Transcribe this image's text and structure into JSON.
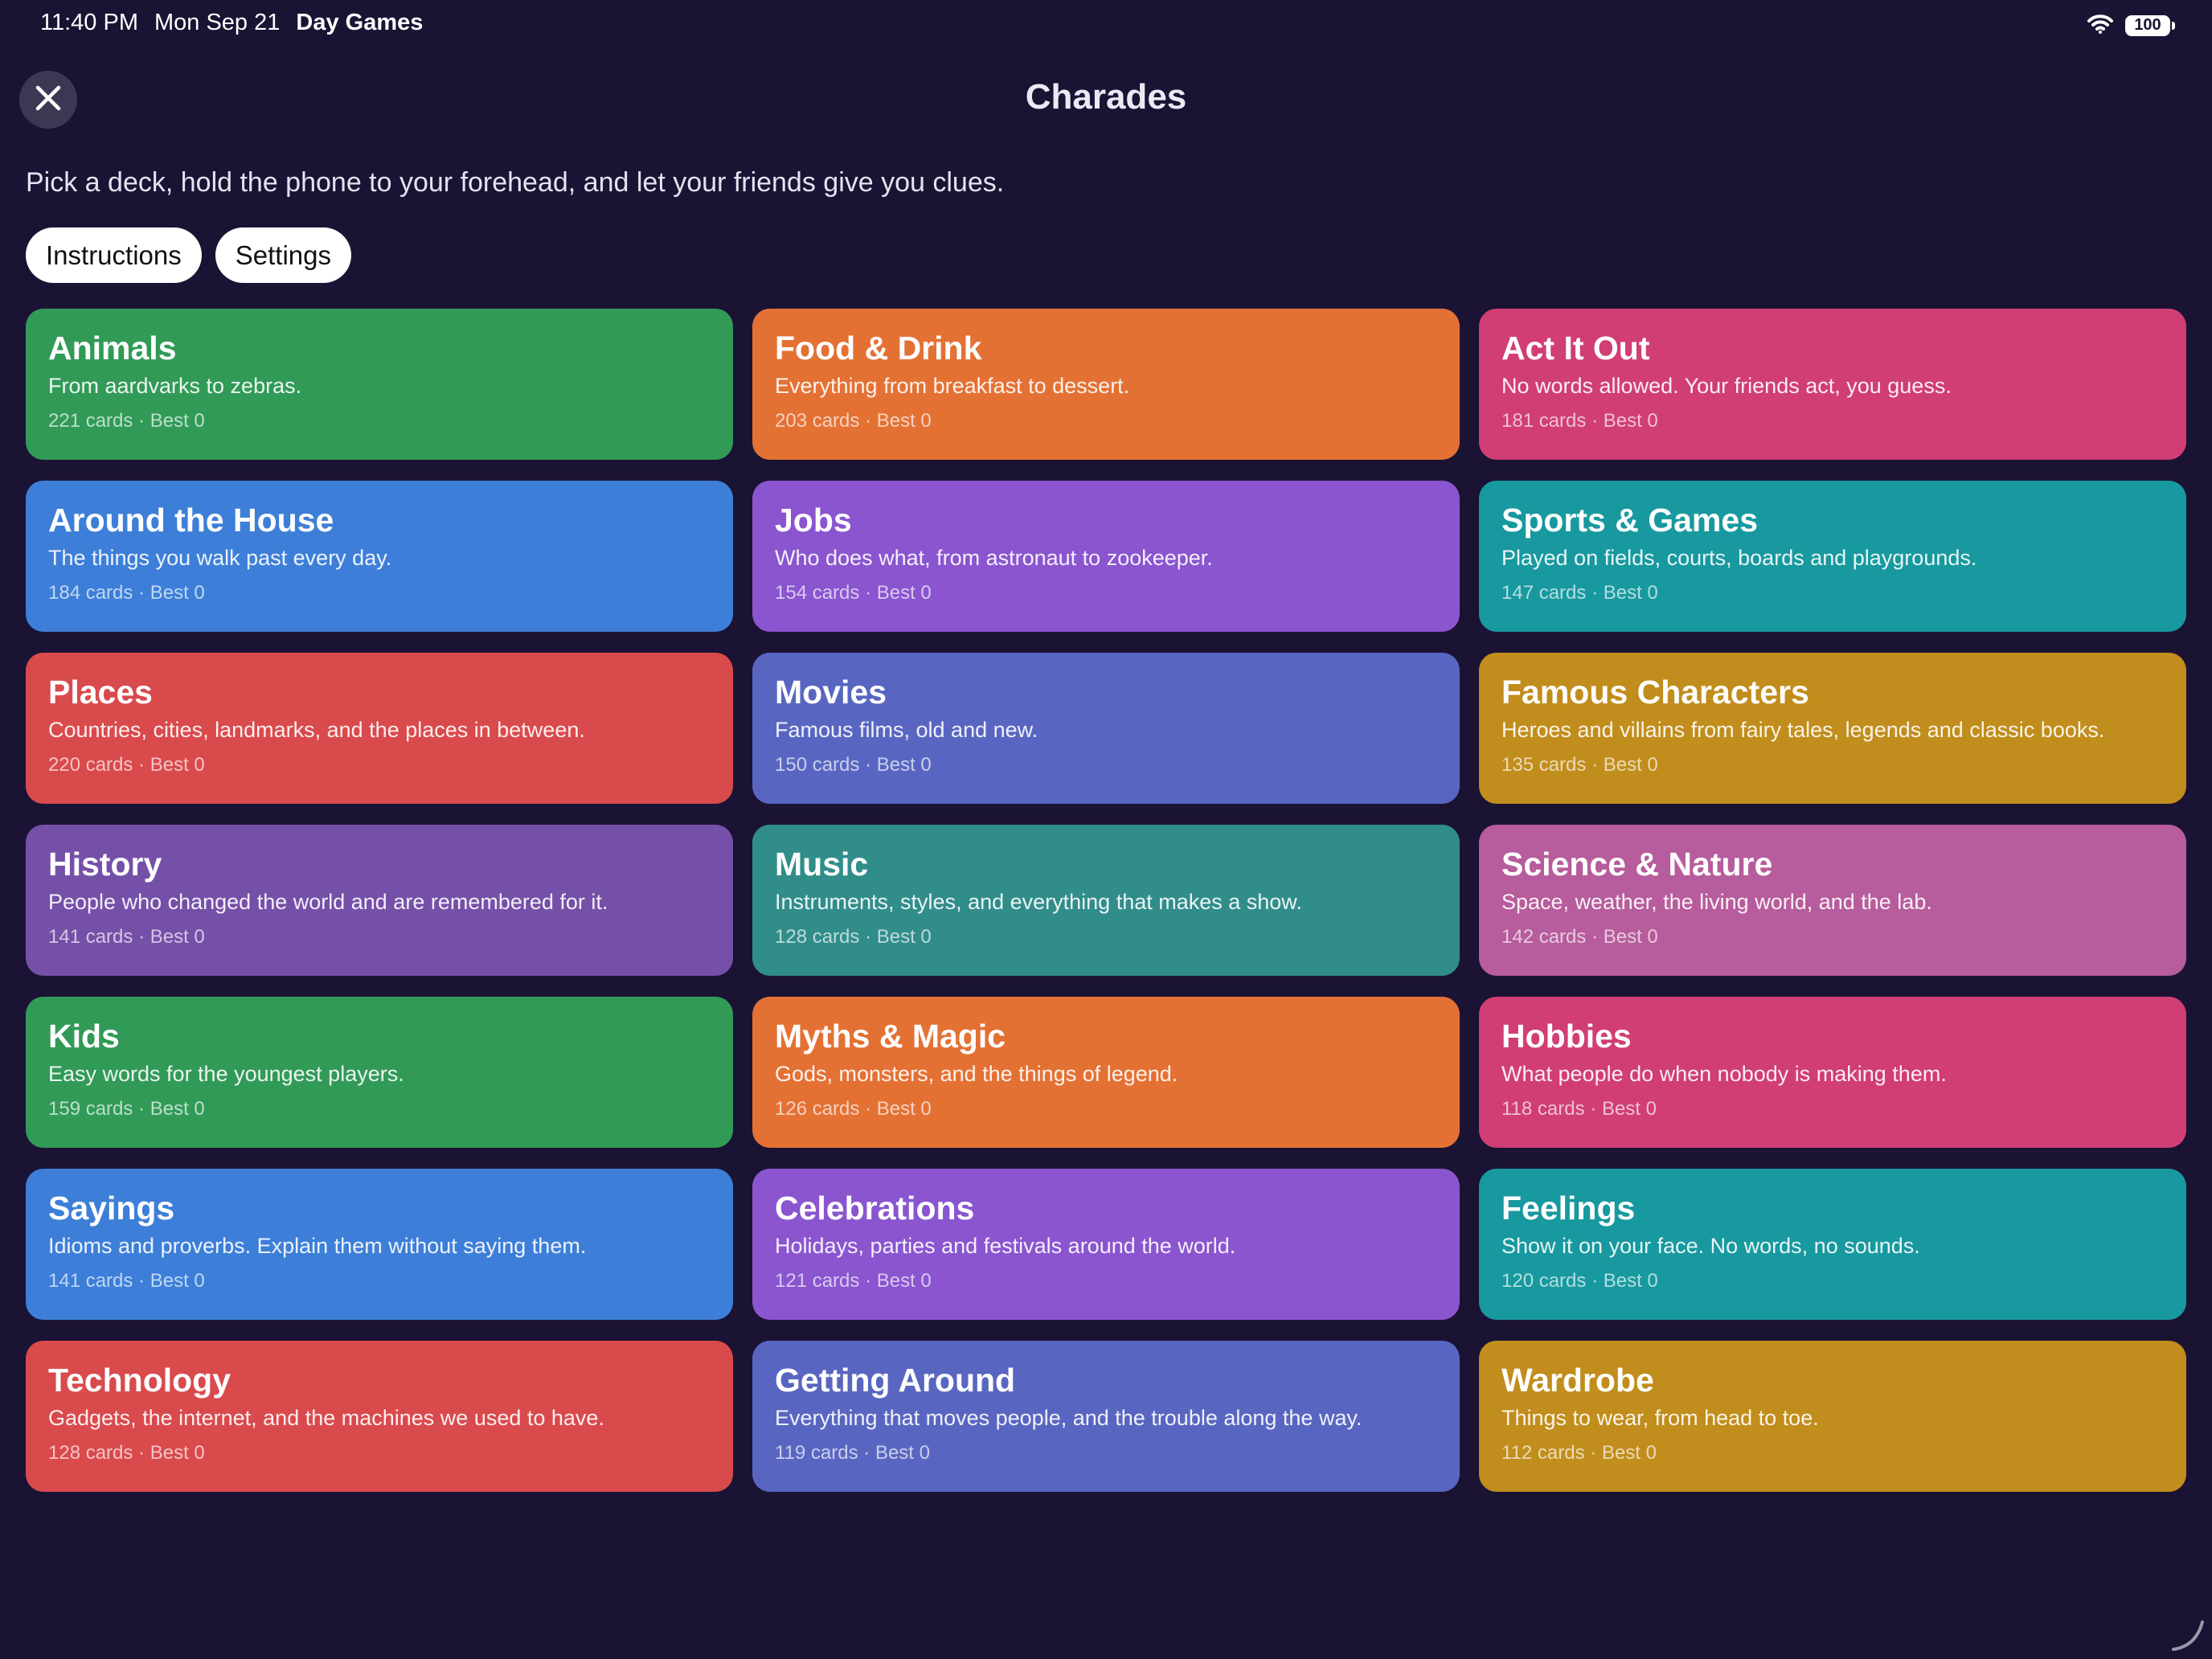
{
  "status_bar": {
    "time": "11:40 PM",
    "date": "Mon Sep 21",
    "app_name": "Day Games",
    "battery": "100"
  },
  "header": {
    "title": "Charades"
  },
  "subtitle": "Pick a deck, hold the phone to your forehead, and let your friends give you clues.",
  "buttons": {
    "instructions": "Instructions",
    "settings": "Settings"
  },
  "decks": [
    {
      "name": "Animals",
      "description": "From aardvarks to zebras.",
      "meta": "221 cards · Best 0",
      "color": "#319a57"
    },
    {
      "name": "Food & Drink",
      "description": "Everything from breakfast to dessert.",
      "meta": "203 cards · Best 0",
      "color": "#e47134"
    },
    {
      "name": "Act It Out",
      "description": "No words allowed. Your friends act, you guess.",
      "meta": "181 cards · Best 0",
      "color": "#d03e74"
    },
    {
      "name": "Around the House",
      "description": "The things you walk past every day.",
      "meta": "184 cards · Best 0",
      "color": "#3d7fd8"
    },
    {
      "name": "Jobs",
      "description": "Who does what, from astronaut to zookeeper.",
      "meta": "154 cards · Best 0",
      "color": "#8a55cf"
    },
    {
      "name": "Sports & Games",
      "description": "Played on fields, courts, boards and playgrounds.",
      "meta": "147 cards · Best 0",
      "color": "#17999f"
    },
    {
      "name": "Places",
      "description": "Countries, cities, landmarks, and the places in between.",
      "meta": "220 cards · Best 0",
      "color": "#d94a4d"
    },
    {
      "name": "Movies",
      "description": "Famous films, old and new.",
      "meta": "150 cards · Best 0",
      "color": "#5966c1"
    },
    {
      "name": "Famous Characters",
      "description": "Heroes and villains from fairy tales, legends and classic books.",
      "meta": "135 cards · Best 0",
      "color": "#c18d1c"
    },
    {
      "name": "History",
      "description": "People who changed the world and are remembered for it.",
      "meta": "141 cards · Best 0",
      "color": "#7550a8"
    },
    {
      "name": "Music",
      "description": "Instruments, styles, and everything that makes a show.",
      "meta": "128 cards · Best 0",
      "color": "#318d8a"
    },
    {
      "name": "Science & Nature",
      "description": "Space, weather, the living world, and the lab.",
      "meta": "142 cards · Best 0",
      "color": "#b75c9c"
    },
    {
      "name": "Kids",
      "description": "Easy words for the youngest players.",
      "meta": "159 cards · Best 0",
      "color": "#319a57"
    },
    {
      "name": "Myths & Magic",
      "description": "Gods, monsters, and the things of legend.",
      "meta": "126 cards · Best 0",
      "color": "#e47134"
    },
    {
      "name": "Hobbies",
      "description": "What people do when nobody is making them.",
      "meta": "118 cards · Best 0",
      "color": "#d03e74"
    },
    {
      "name": "Sayings",
      "description": "Idioms and proverbs. Explain them without saying them.",
      "meta": "141 cards · Best 0",
      "color": "#3d7fd8"
    },
    {
      "name": "Celebrations",
      "description": "Holidays, parties and festivals around the world.",
      "meta": "121 cards · Best 0",
      "color": "#8a55cf"
    },
    {
      "name": "Feelings",
      "description": "Show it on your face. No words, no sounds.",
      "meta": "120 cards · Best 0",
      "color": "#17999f"
    },
    {
      "name": "Technology",
      "description": "Gadgets, the internet, and the machines we used to have.",
      "meta": "128 cards · Best 0",
      "color": "#d94a4d"
    },
    {
      "name": "Getting Around",
      "description": "Everything that moves people, and the trouble along the way.",
      "meta": "119 cards · Best 0",
      "color": "#5966c1"
    },
    {
      "name": "Wardrobe",
      "description": "Things to wear, from head to toe.",
      "meta": "112 cards · Best 0",
      "color": "#c18d1c"
    }
  ]
}
